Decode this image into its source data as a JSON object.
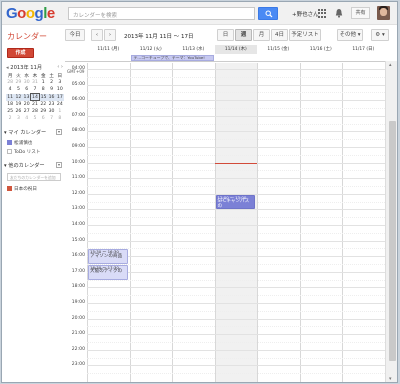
{
  "header": {
    "logo_letters": [
      {
        "ch": "G",
        "color": "#3366cc"
      },
      {
        "ch": "o",
        "color": "#d73b2e"
      },
      {
        "ch": "o",
        "color": "#f2b600"
      },
      {
        "ch": "g",
        "color": "#3366cc"
      },
      {
        "ch": "l",
        "color": "#2f9d47"
      },
      {
        "ch": "e",
        "color": "#d73b2e"
      }
    ],
    "search_placeholder": "カレンダーを検索",
    "user_name": "+野也さん",
    "share_label": "共有"
  },
  "toolbar": {
    "title": "カレンダー",
    "today_label": "今日",
    "prev_label": "‹",
    "next_label": "›",
    "date_range": "2013年 11月 11日 〜 17日",
    "views": [
      {
        "label": "日",
        "selected": false
      },
      {
        "label": "週",
        "selected": true
      },
      {
        "label": "月",
        "selected": false
      },
      {
        "label": "4日",
        "selected": false
      },
      {
        "label": "予定リスト",
        "selected": false
      }
    ],
    "more_label": "その他 ▾",
    "settings_label": "⚙ ▾"
  },
  "sidebar": {
    "create_label": "作成",
    "mini_title": "2013年 11月",
    "weekdays": [
      "月",
      "火",
      "水",
      "木",
      "金",
      "土",
      "日"
    ],
    "weeks": [
      [
        "28",
        "29",
        "30",
        "31",
        "1",
        "2",
        "3"
      ],
      [
        "4",
        "5",
        "6",
        "7",
        "8",
        "9",
        "10"
      ],
      [
        "11",
        "12",
        "13",
        "14",
        "15",
        "16",
        "17"
      ],
      [
        "18",
        "19",
        "20",
        "21",
        "22",
        "23",
        "24"
      ],
      [
        "25",
        "26",
        "27",
        "28",
        "29",
        "30",
        "1"
      ],
      [
        "2",
        "3",
        "4",
        "5",
        "6",
        "7",
        "8"
      ]
    ],
    "my_calendars_label": "マイ カレンダー",
    "my_calendars": [
      {
        "label": "松浦慎也",
        "color": "#7b80d6"
      },
      {
        "label": "ToDo リスト",
        "color": "#ffffff"
      }
    ],
    "other_calendars_label": "他のカレンダー",
    "other_input_placeholder": "友だちのカレンダーを追加",
    "other_calendars": [
      {
        "label": "日本の祝日",
        "color": "#d0563d"
      }
    ]
  },
  "week": {
    "days": [
      "11/11 (月)",
      "11/12 (火)",
      "11/13 (水)",
      "11/14 (木)",
      "11/15 (金)",
      "11/16 (土)",
      "11/17 (日)"
    ],
    "today_index": 3,
    "timezone": "GMT+09",
    "allday_event": {
      "text": "テ...コーチューブで、テーマ：YouTube!",
      "start_day": 1,
      "span_days": 2
    },
    "hours": [
      "04:00",
      "05:00",
      "06:00",
      "07:00",
      "08:00",
      "09:00",
      "10:00",
      "11:00",
      "12:00",
      "13:00",
      "14:00",
      "15:00",
      "16:00",
      "17:00",
      "18:00",
      "19:00",
      "20:00",
      "21:00",
      "22:00",
      "23:00"
    ],
    "now_hour": 10.0,
    "events": [
      {
        "day": 3,
        "start": 12.0,
        "end": 13.0,
        "style": "dark",
        "time": "12:00 〜 13:00",
        "title": "SFCキャンパスの"
      },
      {
        "day": 0,
        "start": 15.5,
        "end": 16.5,
        "style": "light",
        "time": "15:30 〜 16:30",
        "title": "アマゾンの商品"
      },
      {
        "day": 0,
        "start": 16.5,
        "end": 17.5,
        "style": "light",
        "time": "16:30 〜 17:30",
        "title": "大阪のテイクの"
      }
    ]
  }
}
